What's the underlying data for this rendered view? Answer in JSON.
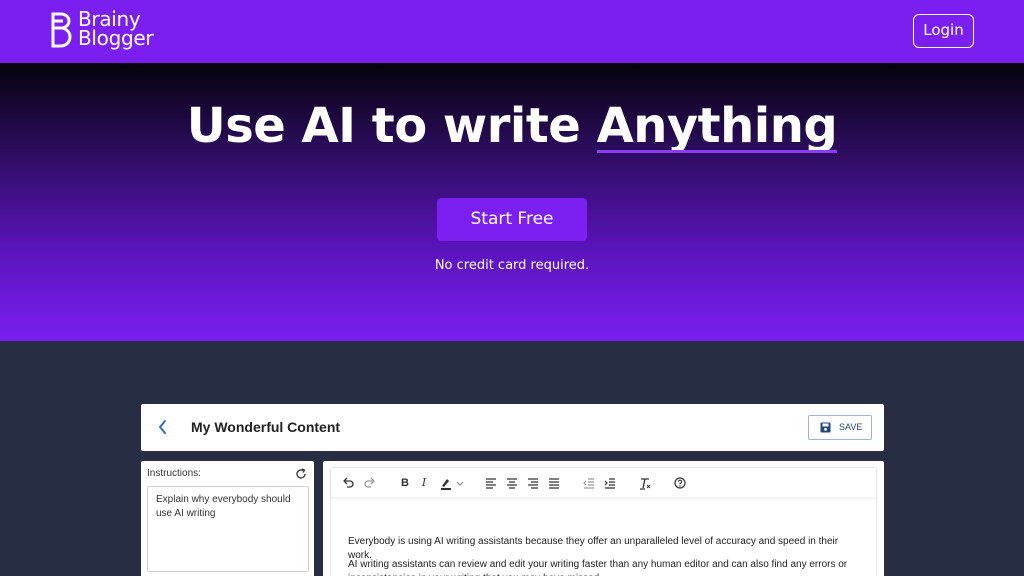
{
  "brand": {
    "line1": "Brainy",
    "line2": "Blogger"
  },
  "nav": {
    "login_label": "Login"
  },
  "hero": {
    "headline_prefix": "Use AI to write ",
    "headline_highlight": "Anything",
    "cta_label": "Start Free",
    "subnote": "No credit card required."
  },
  "app": {
    "doc_title": "My Wonderful Content",
    "save_label": "SAVE",
    "instructions_label": "Instructions:",
    "instructions_value": "Explain why everybody should use AI writing",
    "paragraphs": [
      "Everybody is using AI writing assistants because they offer an unparalleled level of accuracy and speed in their work.",
      "AI writing assistants can review and edit your writing faster than any human editor and can also find any errors or inconsistencies in your writing that you may have missed."
    ]
  },
  "colors": {
    "brand_purple": "#7a1ff0",
    "dark_bg": "#272d43"
  }
}
